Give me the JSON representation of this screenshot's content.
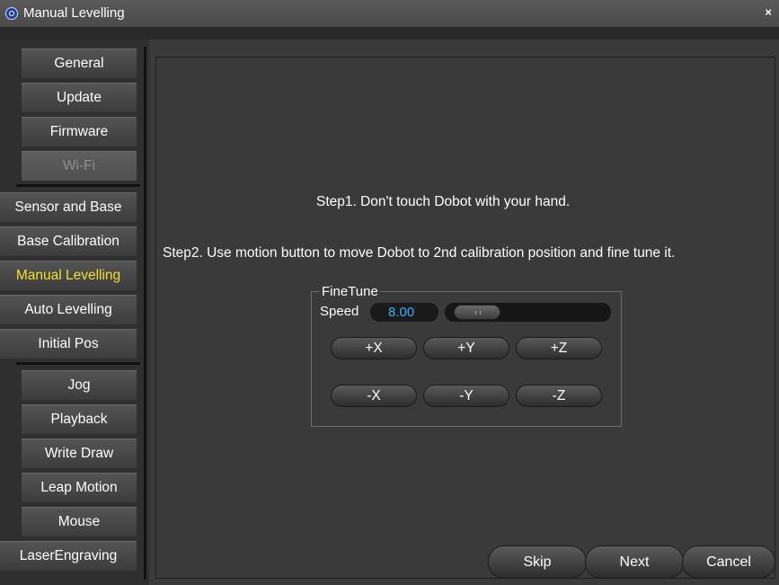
{
  "window": {
    "title": "Manual Levelling",
    "close_glyph": "×",
    "icon": "dobot-app-icon"
  },
  "sidebar": {
    "items": [
      {
        "label": "General"
      },
      {
        "label": "Update"
      },
      {
        "label": "Firmware"
      },
      {
        "label": "Wi-Fi",
        "state": "disabled"
      },
      {
        "label": "Sensor and Base"
      },
      {
        "label": "Base Calibration"
      },
      {
        "label": "Manual Levelling",
        "state": "active"
      },
      {
        "label": "Auto Levelling"
      },
      {
        "label": "Initial Pos"
      },
      {
        "label": "Jog"
      },
      {
        "label": "Playback"
      },
      {
        "label": "Write  Draw"
      },
      {
        "label": "Leap Motion"
      },
      {
        "label": "Mouse"
      },
      {
        "label": "LaserEngraving"
      }
    ],
    "active_color": "#f2e02a"
  },
  "main": {
    "step1": "Step1. Don't touch Dobot with your hand.",
    "step2": "Step2. Use motion button to move Dobot to 2nd calibration position and fine tune it.",
    "finetune": {
      "title": "FineTune",
      "speed_label": "Speed",
      "speed_value": "8.00",
      "speed_value_color": "#32b4ff",
      "buttons": [
        "+X",
        "+Y",
        "+Z",
        "-X",
        "-Y",
        "-Z"
      ]
    },
    "footer": {
      "skip": "Skip",
      "next": "Next",
      "cancel": "Cancel"
    }
  }
}
